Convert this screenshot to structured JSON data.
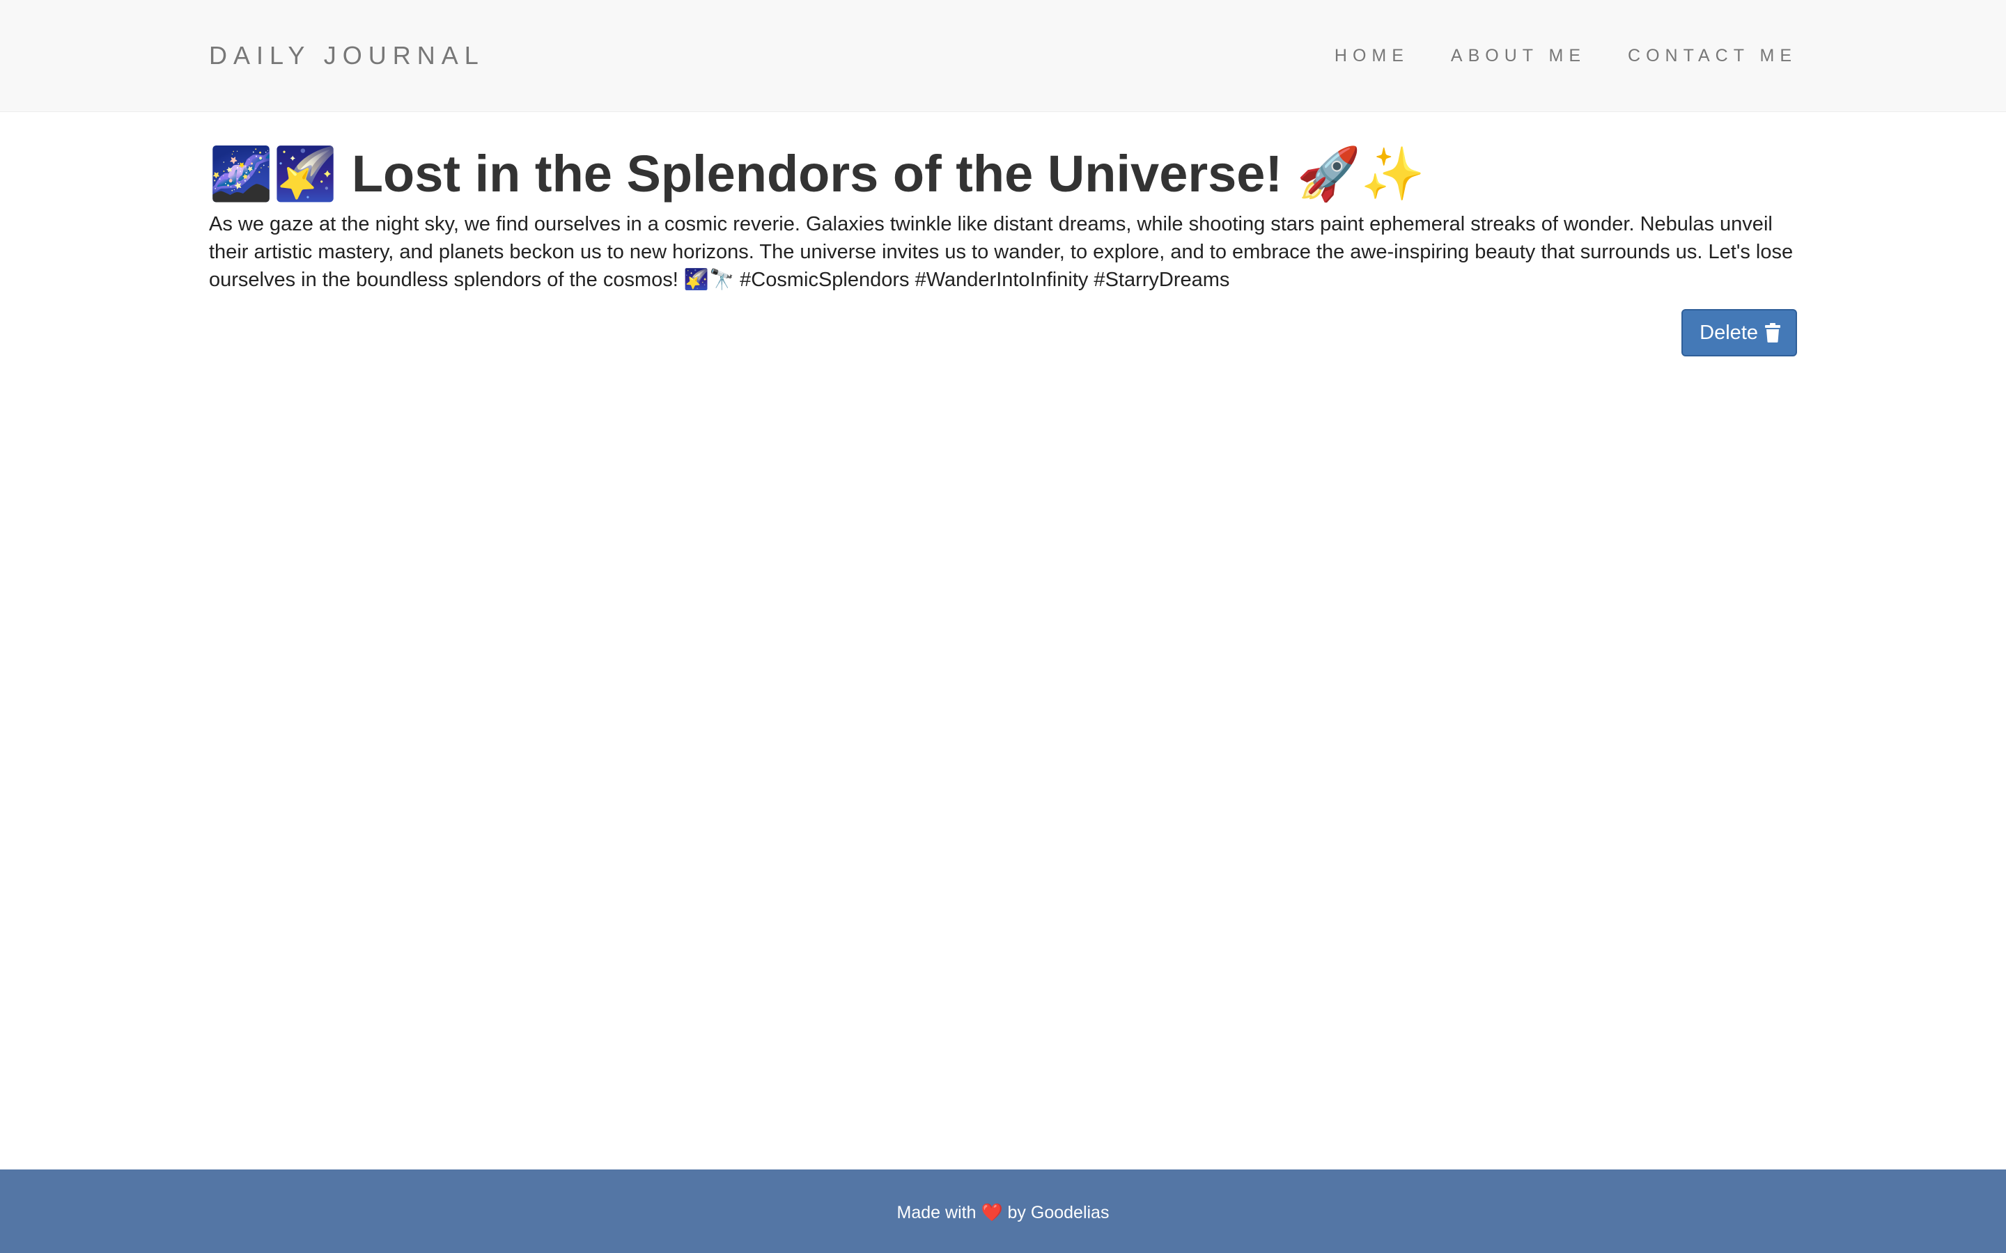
{
  "nav": {
    "brand": "DAILY JOURNAL",
    "links": [
      "HOME",
      "ABOUT ME",
      "CONTACT ME"
    ]
  },
  "post": {
    "title": "🌌🌠 Lost in the Splendors of the Universe! 🚀✨",
    "body": "As we gaze at the night sky, we find ourselves in a cosmic reverie. Galaxies twinkle like distant dreams, while shooting stars paint ephemeral streaks of wonder. Nebulas unveil their artistic mastery, and planets beckon us to new horizons. The universe invites us to wander, to explore, and to embrace the awe-inspiring beauty that surrounds us. Let's lose ourselves in the boundless splendors of the cosmos! 🌠🔭 #CosmicSplendors #WanderIntoInfinity #StarryDreams",
    "delete_label": "Delete"
  },
  "footer": {
    "prefix": "Made with",
    "heart": "❤️",
    "suffix": "by Goodelias"
  },
  "colors": {
    "navbar_bg": "#f8f8f8",
    "button_bg": "#4479b7",
    "footer_bg": "#5476a5"
  },
  "icons": {
    "delete": "trash-icon",
    "footer": "heart-icon"
  }
}
